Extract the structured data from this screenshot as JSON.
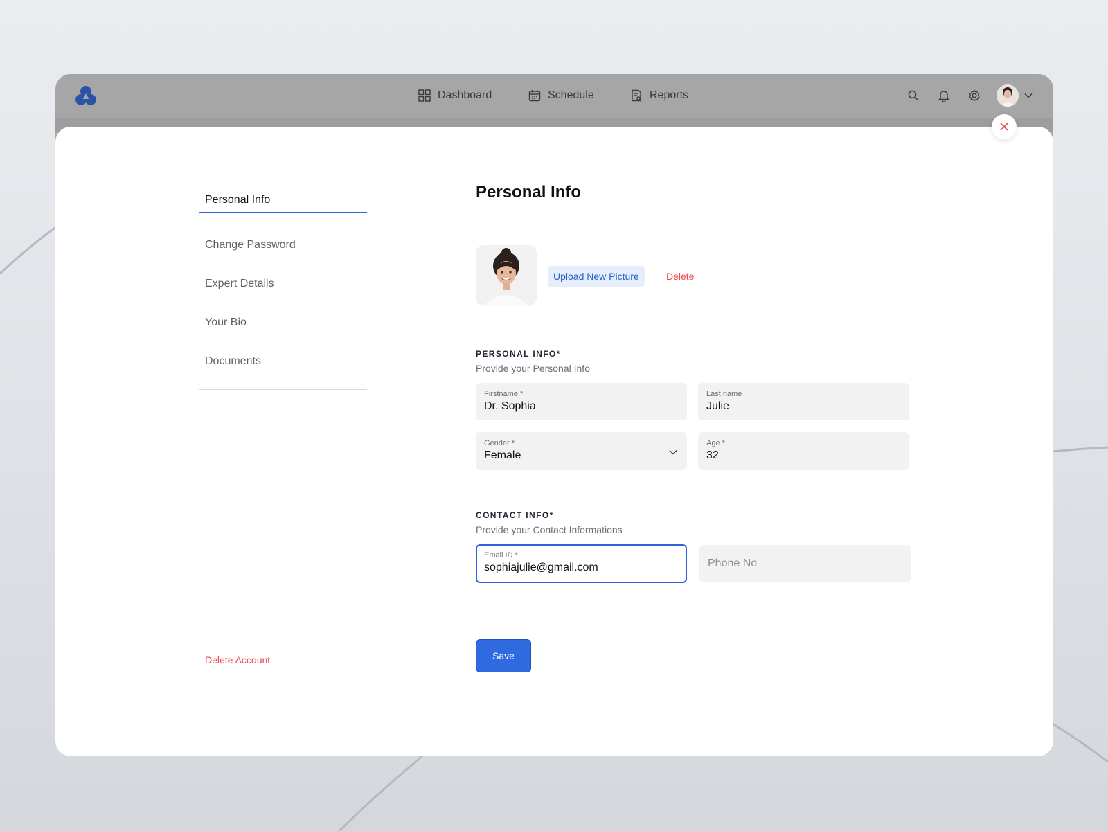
{
  "nav": {
    "items": [
      {
        "label": "Dashboard",
        "icon": "grid-icon"
      },
      {
        "label": "Schedule",
        "icon": "calendar-icon"
      },
      {
        "label": "Reports",
        "icon": "report-icon"
      }
    ]
  },
  "sidebar": {
    "items": [
      {
        "label": "Personal Info",
        "active": true
      },
      {
        "label": "Change Password"
      },
      {
        "label": "Expert Details"
      },
      {
        "label": "Your Bio"
      },
      {
        "label": "Documents"
      }
    ],
    "delete_account": "Delete Account"
  },
  "main": {
    "title": "Personal Info",
    "upload_label": "Upload New Picture",
    "delete_label": "Delete",
    "personal": {
      "title": "PERSONAL INFO*",
      "subtitle": "Provide your Personal Info",
      "firstname": {
        "label": "Firstname *",
        "value": "Dr. Sophia"
      },
      "lastname": {
        "label": "Last name",
        "value": "Julie"
      },
      "gender": {
        "label": "Gender *",
        "value": "Female"
      },
      "age": {
        "label": "Age *",
        "value": "32"
      }
    },
    "contact": {
      "title": "CONTACT INFO*",
      "subtitle": "Provide your Contact Informations",
      "email": {
        "label": "Email ID *",
        "value": "sophiajulie@gmail.com"
      },
      "phone": {
        "placeholder": "Phone No"
      }
    },
    "save_label": "Save"
  },
  "colors": {
    "accent": "#2f6ae0",
    "danger": "#f0454f",
    "logo": "#2a52a8"
  }
}
